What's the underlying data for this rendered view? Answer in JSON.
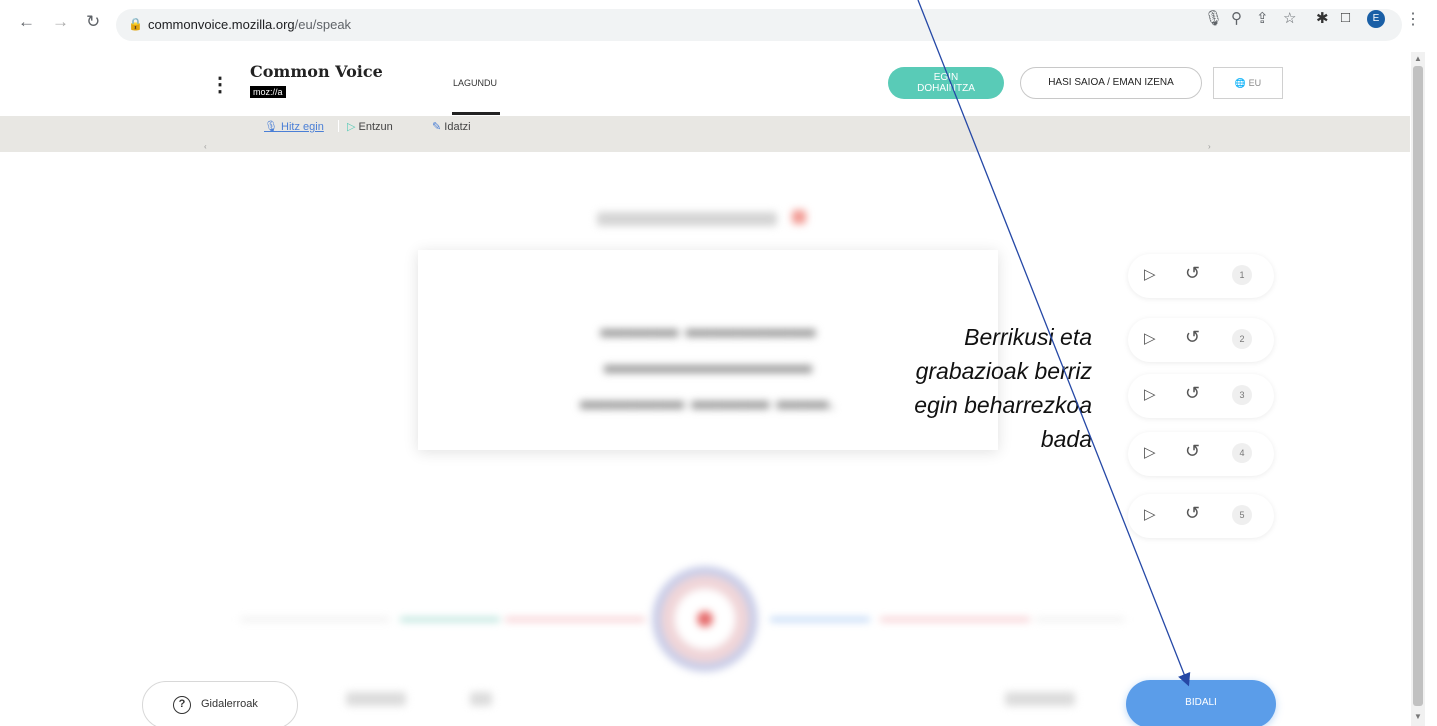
{
  "browser": {
    "url_host": "commonvoice.mozilla.org",
    "url_path": "/eu/speak",
    "profile_initial": "E"
  },
  "header": {
    "logo_title": "Common Voice",
    "logo_sub": "moz://a",
    "nav_help": "LAGUNDU",
    "donate_line1": "EGIN",
    "donate_line2": "DOHAINTZA",
    "login_label": "HASI SAIOA / EMAN IZENA",
    "language": "EU"
  },
  "tabs": {
    "speak": "Hitz egin",
    "listen": "Entzun",
    "write": "Idatzi"
  },
  "recordings": [
    {
      "number": "1"
    },
    {
      "number": "2"
    },
    {
      "number": "3"
    },
    {
      "number": "4"
    },
    {
      "number": "5"
    }
  ],
  "annotation": {
    "line1": "Berrikusi eta",
    "line2": "grabazioak berriz",
    "line3": "egin beharrezkoa",
    "line4": "bada"
  },
  "footer": {
    "guidelines_label": "Gidalerroak",
    "submit_label": "BIDALI"
  },
  "colors": {
    "accent": "#5b9de9",
    "donate": "#59cbb7",
    "tab_active": "#4a7fd6"
  }
}
